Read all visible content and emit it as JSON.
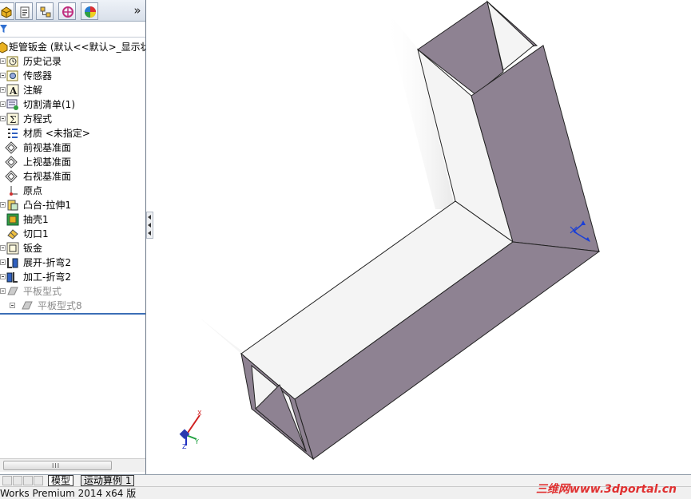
{
  "feature_manager": {
    "tabs": [
      {
        "name": "featuremanager-tab-icon"
      },
      {
        "name": "propertymanager-tab-icon"
      },
      {
        "name": "configurationmanager-tab-icon"
      },
      {
        "name": "dimxpert-tab-icon"
      },
      {
        "name": "display-manager-tab-icon"
      }
    ],
    "more_label": "»",
    "tree": [
      {
        "label": "矩管钣金 (默认<<默认>_显示状",
        "icon": "part-icon",
        "dim": false
      },
      {
        "label": "历史记录",
        "icon": "history-icon",
        "dim": false
      },
      {
        "label": "传感器",
        "icon": "sensor-icon",
        "dim": false
      },
      {
        "label": "注解",
        "icon": "annotation-icon",
        "dim": false
      },
      {
        "label": "切割清单(1)",
        "icon": "cut-list-icon",
        "dim": false
      },
      {
        "label": "方程式",
        "icon": "equation-icon",
        "dim": false
      },
      {
        "label": "材质 <未指定>",
        "icon": "material-icon",
        "dim": false
      },
      {
        "label": "前视基准面",
        "icon": "plane-icon",
        "dim": false
      },
      {
        "label": "上视基准面",
        "icon": "plane-icon",
        "dim": false
      },
      {
        "label": "右视基准面",
        "icon": "plane-icon",
        "dim": false
      },
      {
        "label": "原点",
        "icon": "origin-icon",
        "dim": false
      },
      {
        "label": "凸台-拉伸1",
        "icon": "boss-extrude-icon",
        "dim": false
      },
      {
        "label": "抽壳1",
        "icon": "shell-icon",
        "dim": false
      },
      {
        "label": "切口1",
        "icon": "rip-icon",
        "dim": false
      },
      {
        "label": "钣金",
        "icon": "sheet-metal-icon",
        "dim": false
      },
      {
        "label": "展开-折弯2",
        "icon": "unfold-icon",
        "dim": false
      },
      {
        "label": "加工-折弯2",
        "icon": "process-bend-icon",
        "dim": false
      },
      {
        "label": "平板型式",
        "icon": "flat-pattern-icon",
        "dim": true
      },
      {
        "label": "平板型式8",
        "icon": "flat-pattern-icon",
        "dim": true
      }
    ]
  },
  "bottom_tabs": [
    {
      "label": "模型",
      "active": true
    },
    {
      "label": "运动算例 1",
      "active": false
    }
  ],
  "status_bar": {
    "text": "Works Premium 2014 x64 版"
  },
  "watermark": {
    "text": "三维网www.3dportal.cn"
  },
  "triad": {
    "x_label": "X",
    "y_label": "Y",
    "z_label": "Z"
  },
  "colors": {
    "face": "#8e8292",
    "face_light": "#f4f4f4",
    "accent_blue": "#3c6fb6"
  }
}
